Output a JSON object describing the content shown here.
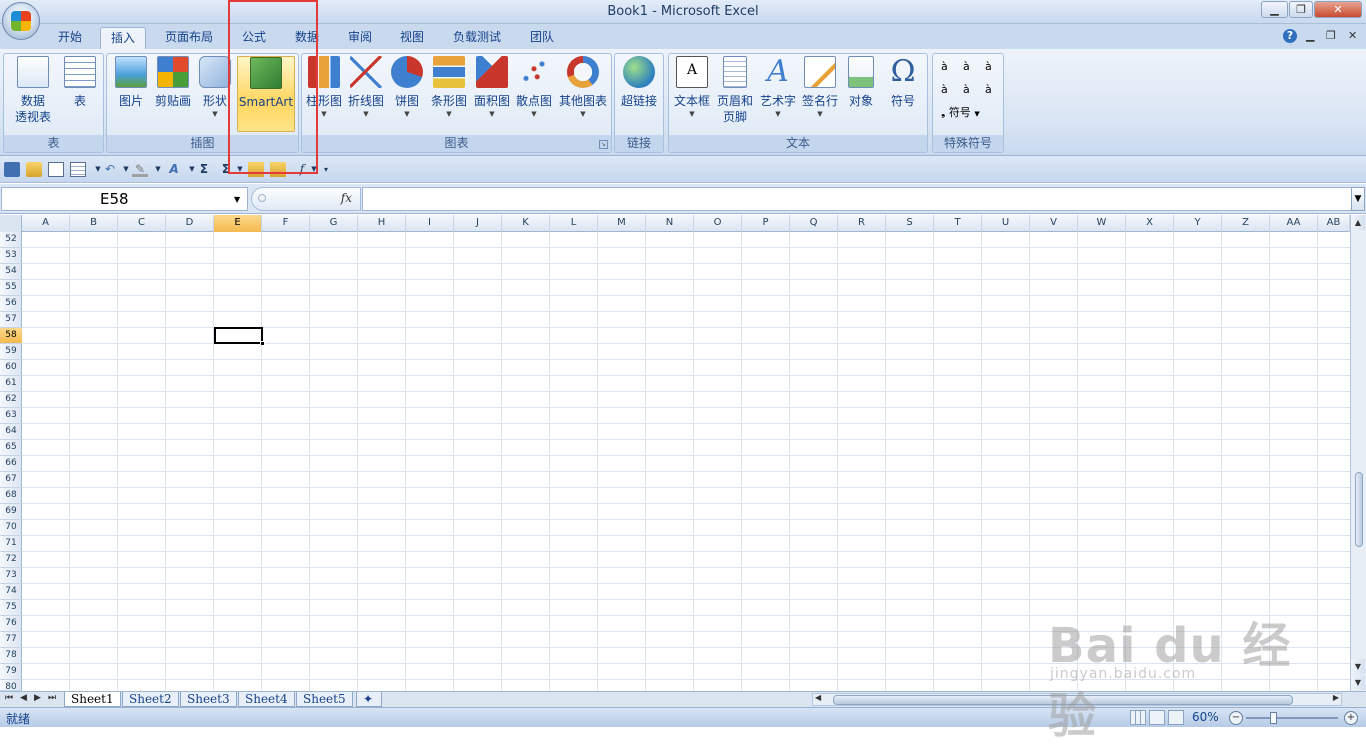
{
  "window": {
    "title": "Book1 - Microsoft Excel"
  },
  "tabs": [
    "开始",
    "插入",
    "页面布局",
    "公式",
    "数据",
    "审阅",
    "视图",
    "负载测试",
    "团队"
  ],
  "ribbon": {
    "groups": {
      "table": {
        "label": "表",
        "buttons": [
          "数据\n透视表",
          "表"
        ]
      },
      "illustrations": {
        "label": "插图",
        "buttons": [
          "图片",
          "剪贴画",
          "形状",
          "SmartArt"
        ]
      },
      "charts": {
        "label": "图表",
        "buttons": [
          "柱形图",
          "折线图",
          "饼图",
          "条形图",
          "面积图",
          "散点图",
          "其他图表"
        ]
      },
      "links": {
        "label": "链接",
        "buttons": [
          "超链接"
        ]
      },
      "text": {
        "label": "文本",
        "buttons": [
          "文本框",
          "页眉和\n页脚",
          "艺术字",
          "签名行",
          "对象",
          "符号"
        ]
      },
      "special": {
        "label": "特殊符号",
        "symbols": [
          "à",
          "à",
          "à",
          "à",
          "à",
          "à"
        ],
        "symbol_button": "符号"
      }
    }
  },
  "formula_bar": {
    "name_box": "E58",
    "fx": "fx",
    "value": ""
  },
  "grid": {
    "columns": [
      "A",
      "B",
      "C",
      "D",
      "E",
      "F",
      "G",
      "H",
      "I",
      "J",
      "K",
      "L",
      "M",
      "N",
      "O",
      "P",
      "Q",
      "R",
      "S",
      "T",
      "U",
      "V",
      "W",
      "X",
      "Y",
      "Z",
      "AA",
      "AB"
    ],
    "rows": [
      "52",
      "53",
      "54",
      "55",
      "56",
      "57",
      "58",
      "59",
      "60",
      "61",
      "62",
      "63",
      "64",
      "65",
      "66",
      "67",
      "68",
      "69",
      "70",
      "71",
      "72",
      "73",
      "74",
      "75",
      "76",
      "77",
      "78",
      "79",
      "80"
    ],
    "selected_column": "E",
    "selected_row": "58"
  },
  "sheets": [
    "Sheet1",
    "Sheet2",
    "Sheet3",
    "Sheet4",
    "Sheet5"
  ],
  "active_sheet": "Sheet1",
  "status": {
    "text": "就绪",
    "zoom": "60%"
  },
  "watermark": {
    "line1": "Bai du 经验",
    "line2": "jingyan.baidu.com"
  },
  "colors": {
    "accent": "#15428b",
    "highlight": "#ffd660",
    "annotation": "#e53a3a"
  }
}
